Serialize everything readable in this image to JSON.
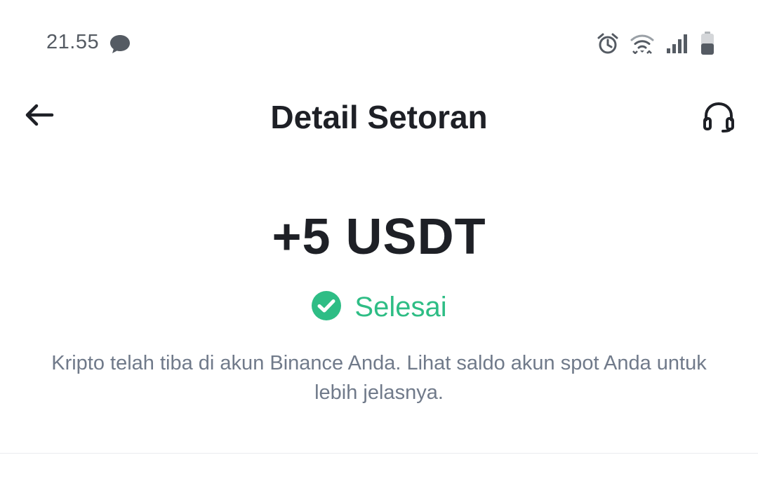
{
  "status_bar": {
    "time": "21.55",
    "icons": [
      "chat-bubble-icon",
      "alarm-icon",
      "wifi-icon",
      "signal-icon",
      "battery-icon"
    ]
  },
  "header": {
    "title": "Detail Setoran",
    "back_icon": "arrow-left-icon",
    "support_icon": "headset-icon"
  },
  "deposit": {
    "amount": "+5 USDT",
    "status": "Selesai",
    "status_icon": "check-circle-icon",
    "description": "Kripto telah tiba di akun Binance Anda. Lihat saldo akun spot Anda untuk lebih jelasnya."
  },
  "colors": {
    "success": "#2ebd85",
    "text_primary": "#1e2026",
    "text_secondary": "#707a8a",
    "divider": "#eaecef"
  }
}
